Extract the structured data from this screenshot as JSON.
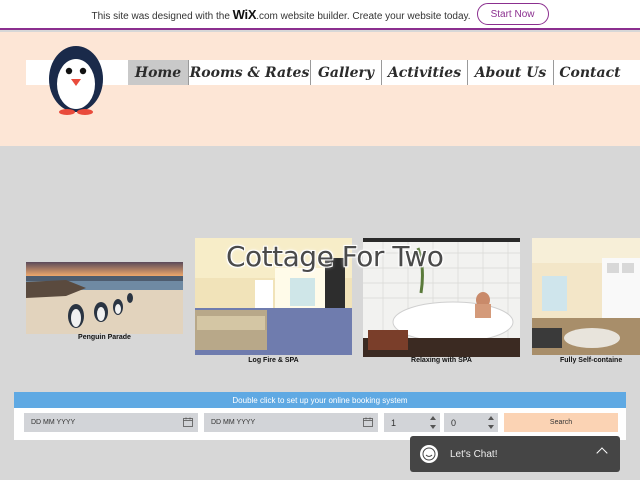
{
  "wix_banner": {
    "text_before": "This site was designed with the",
    "logo": "WiX",
    "logo_suffix": ".com",
    "text_after": "website builder. Create your website today.",
    "button": "Start Now",
    "accent_color": "#8b2f8f"
  },
  "header": {
    "background": "#fde6d6",
    "logo_icon": "penguin-icon",
    "nav": [
      {
        "label": "Home",
        "active": true
      },
      {
        "label": "Rooms & Rates",
        "active": false
      },
      {
        "label": "Gallery",
        "active": false
      },
      {
        "label": "Activities",
        "active": false
      },
      {
        "label": "About Us",
        "active": false
      },
      {
        "label": "Contact",
        "active": false
      }
    ]
  },
  "gallery": {
    "title": "Cottage For Two",
    "items": [
      {
        "caption": "Penguin Parade"
      },
      {
        "caption": "Log Fire & SPA"
      },
      {
        "caption": "Relaxing with SPA"
      },
      {
        "caption": "Fully Self-containe"
      }
    ]
  },
  "booking": {
    "banner": "Double click to set up your online booking system",
    "checkin_placeholder": "DD MM YYYY",
    "checkout_placeholder": "DD MM YYYY",
    "adults": "1",
    "children": "0",
    "search_label": "Search",
    "bar_color": "#5fa9e3",
    "search_color": "#fbd3b4"
  },
  "chat": {
    "label": "Let's Chat!",
    "icon": "chat-smile-icon",
    "expand_icon": "chevron-up-icon"
  }
}
